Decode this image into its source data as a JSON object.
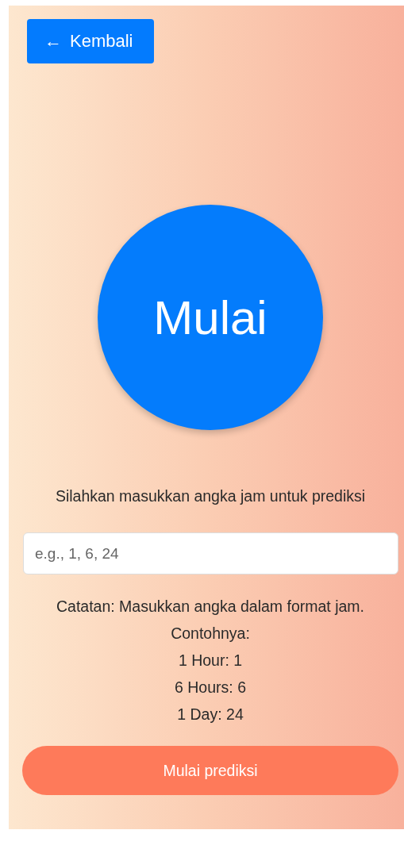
{
  "back_button": {
    "icon": "←",
    "label": "Kembali"
  },
  "start_button": {
    "label": "Mulai"
  },
  "prompt": "Silahkan masukkan angka jam untuk prediksi",
  "hours_field": {
    "placeholder": "e.g., 1, 6, 24"
  },
  "notes": [
    "Catatan: Masukkan angka dalam format jam.",
    "Contohnya:",
    "1 Hour: 1",
    "6 Hours: 6",
    "1 Day: 24"
  ],
  "submit_button": {
    "label": "Mulai prediksi"
  }
}
